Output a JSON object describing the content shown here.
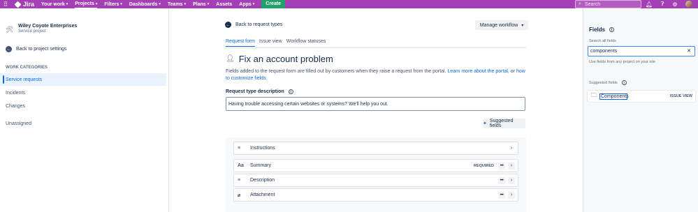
{
  "topnav": {
    "brand": "Jira",
    "items": [
      {
        "label": "Your work",
        "chevron": true
      },
      {
        "label": "Projects",
        "chevron": true,
        "active": true
      },
      {
        "label": "Filters",
        "chevron": true
      },
      {
        "label": "Dashboards",
        "chevron": true
      },
      {
        "label": "Teams",
        "chevron": true
      },
      {
        "label": "Plans",
        "chevron": true
      },
      {
        "label": "Assets",
        "chevron": false
      },
      {
        "label": "Apps",
        "chevron": true
      }
    ],
    "create_label": "Create",
    "search_placeholder": "Search",
    "colors": {
      "bar": "#a43fb5",
      "create": "#22a06b"
    }
  },
  "sidebar": {
    "project_name": "Wiley Coyote Enterprises",
    "project_type": "Service project",
    "back_label": "Back to project settings",
    "category_heading": "WORK CATEGORIES",
    "items": [
      {
        "label": "Service requests",
        "selected": true
      },
      {
        "label": "Incidents"
      },
      {
        "label": "Changes"
      },
      {
        "label": "Unassigned"
      }
    ]
  },
  "main": {
    "back_label": "Back to request types",
    "manage_label": "Manage workflow",
    "tabs": [
      {
        "label": "Request form",
        "active": true
      },
      {
        "label": "Issue view"
      },
      {
        "label": "Workflow statuses"
      }
    ],
    "title": "Fix an account problem",
    "description_prefix": "Fields added to the request form are filled out by customers when they raise a request from the portal. ",
    "description_link1": "Learn more about the portal",
    "description_mid": ", or ",
    "description_link2": "how to customize fields",
    "description_suffix": ".",
    "rt_label": "Request type description",
    "rt_value": "Having trouble accessing certain websites or systems? We'll help you out.",
    "suggest_label": "Suggested fields",
    "fields": [
      {
        "label": "Instructions",
        "icon": "≡",
        "required": "",
        "more": false
      },
      {
        "label": "Summary",
        "icon": "Aa",
        "required": "REQUIRED",
        "more": true
      },
      {
        "label": "Description",
        "icon": "≡",
        "required": "",
        "more": true
      },
      {
        "label": "Attachment",
        "icon": "⌀",
        "required": "",
        "more": true
      }
    ]
  },
  "rpanel": {
    "title": "Fields",
    "search_label": "Search all fields",
    "search_value": "components",
    "help": "Use fields from any project on your site",
    "suggested_heading": "Suggested fields",
    "suggested": [
      {
        "label": "Components",
        "lozenge": "ISSUE VIEW"
      }
    ]
  }
}
